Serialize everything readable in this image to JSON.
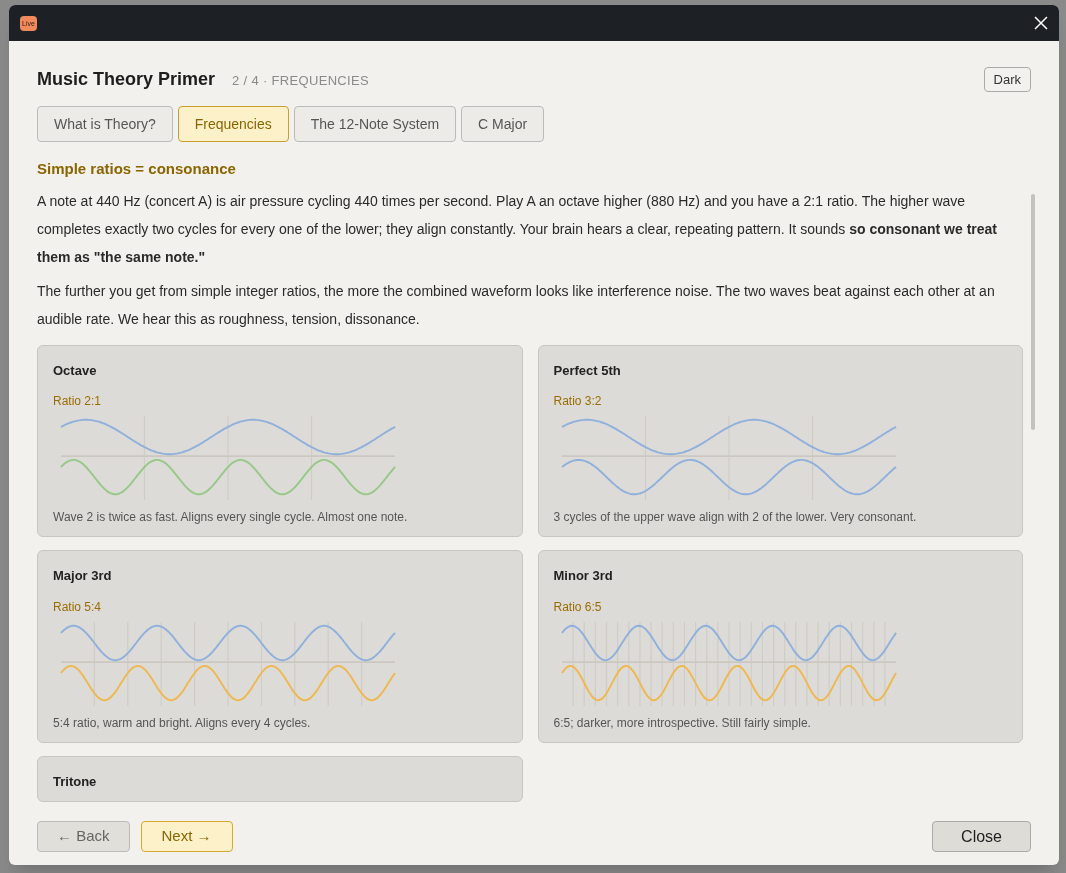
{
  "window": {
    "app_badge": "Live"
  },
  "header": {
    "title": "Music Theory Primer",
    "step": "2 / 4 · FREQUENCIES",
    "theme_button": "Dark"
  },
  "tabs": [
    {
      "label": "What is Theory?",
      "selected": false
    },
    {
      "label": "Frequencies",
      "selected": true
    },
    {
      "label": "The 12-Note System",
      "selected": false
    },
    {
      "label": "C Major",
      "selected": false
    }
  ],
  "section_heading": "Simple ratios = consonance",
  "paragraphs": [
    "A note at 440 Hz (concert A) is air pressure cycling 440 times per second. Play A an octave higher (880 Hz) and you have a 2:1 ratio. The higher wave completes exactly two cycles for every one of the lower; they align constantly. Your brain hears a clear, repeating pattern. It sounds **so consonant we treat them as \"the same note.\"**",
    "The further you get from simple integer ratios, the more the combined waveform looks like interference noise. The two waves beat against each other at an audible rate. We hear this as roughness, tension, dissonance."
  ],
  "cards": [
    {
      "kind": "octave",
      "title": "Octave",
      "ratio": "Ratio 2:1",
      "waves": [
        {
          "color": "#8fb0dc"
        },
        {
          "color": "#97c887"
        }
      ],
      "caption": "Wave 2 is twice as fast. Aligns every single cycle. Almost one note."
    },
    {
      "kind": "fifth",
      "title": "Perfect 5th",
      "ratio": "Ratio 3:2",
      "waves": [
        {
          "color": "#8fb0dc"
        },
        {
          "color": "#8fb0dc"
        }
      ],
      "caption": "3 cycles of the upper wave align with 2 of the lower. Very consonant."
    },
    {
      "kind": "major_third",
      "title": "Major 3rd",
      "ratio": "Ratio 5:4",
      "waves": [
        {
          "color": "#8fb0dc"
        },
        {
          "color": "#efb84f"
        }
      ],
      "caption": "5:4 ratio, warm and bright. Aligns every 4 cycles."
    },
    {
      "kind": "minor_third",
      "title": "Minor 3rd",
      "ratio": "Ratio 6:5",
      "waves": [
        {
          "color": "#8fb0dc"
        },
        {
          "color": "#efb84f"
        }
      ],
      "caption": "6:5; darker, more introspective. Still fairly simple."
    },
    {
      "title": "Tritone"
    }
  ],
  "footer": {
    "back": "← Back",
    "next": "Next →",
    "close": "Close"
  }
}
